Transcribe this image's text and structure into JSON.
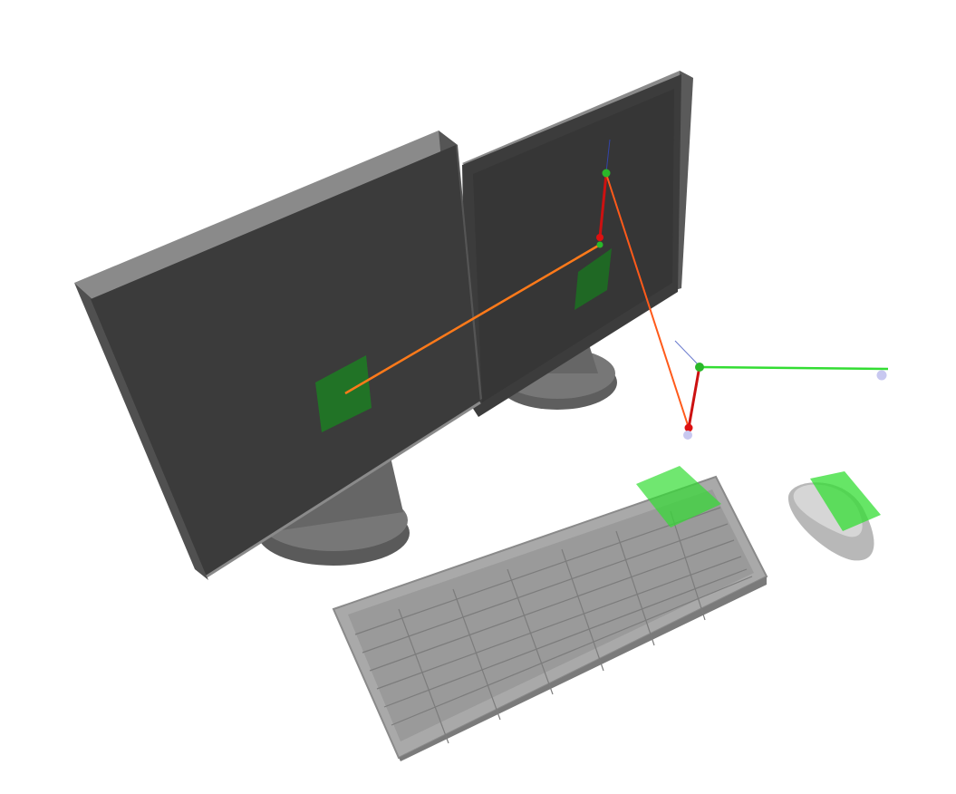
{
  "scene": {
    "background": "#ffffff",
    "objects": [
      "left-monitor",
      "right-monitor",
      "keyboard",
      "mouse"
    ]
  },
  "colors": {
    "monitor_front": "#3a3a3a",
    "monitor_side": "#6e6e6e",
    "monitor_top": "#7a7a7a",
    "stand": "#707070",
    "stand_edge": "#5a5a5a",
    "keyboard_body": "#a8a8a8",
    "keyboard_keys": "#8e8e8e",
    "mouse": "#c8c8c8",
    "target_zone": "#22c55e",
    "link_orange": "#ff7a1a",
    "link_red": "#cc1111",
    "link_green": "#33dd33",
    "joint_green": "#2ab82a",
    "joint_red": "#dd1111",
    "joint_lavender": "#c8c8f0"
  }
}
